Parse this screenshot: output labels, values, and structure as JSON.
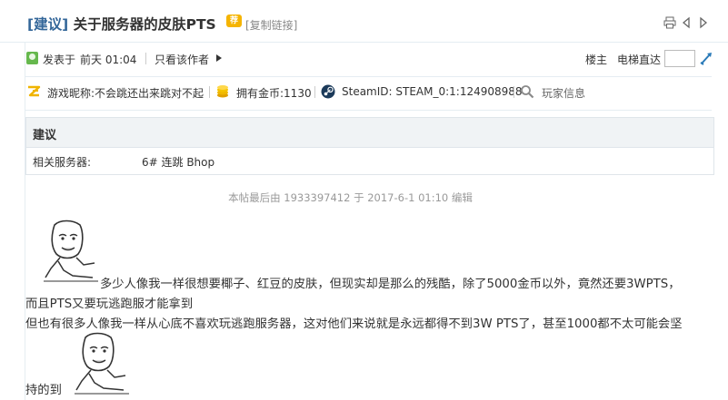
{
  "post": {
    "category": "[建议]",
    "title": "关于服务器的皮肤PTS",
    "hot_badge": "荐",
    "copy_link": "[复制链接]"
  },
  "author_bar": {
    "posted_label": "发表于",
    "posted_time": "前天 01:04",
    "only_author": "只看该作者",
    "floor": "楼主",
    "elevator": "电梯直达"
  },
  "player_info": {
    "nickname": "游戏昵称:不会跳还出来跳对不起",
    "gold": "拥有金币:1130",
    "steam_id": "SteamID: STEAM_0:1:124908988",
    "player_info": "玩家信息"
  },
  "suggestion": {
    "heading": "建议",
    "server_label": "相关服务器:",
    "server_value": "6# 连跳 Bhop"
  },
  "edit_note": "本帖最后由 1933397412 于 2017-6-1 01:10 编辑",
  "body": {
    "line1": "多少人像我一样很想要椰子、红豆的皮肤，但现实却是那么的残酷，除了5000金币以外，竟然还要3WPTS，",
    "line2": "而且PTS又要玩逃跑服才能拿到",
    "line3": "但也有很多人像我一样从心底不喜欢玩逃跑服务器，这对他们来说就是永远都得不到3W PTS了，甚至1000都不太可能会坚",
    "line4": "持的到"
  },
  "icons": {
    "print": "print-icon",
    "prev": "prev-thread-icon",
    "next": "next-thread-icon",
    "author": "author-avatar-icon",
    "nickname": "z-logo-icon",
    "gold": "coins-icon",
    "steam": "steam-icon",
    "search": "magnifier-icon",
    "jump": "jump-icon",
    "face": "meme-face-icon"
  },
  "colors": {
    "category": "#336699",
    "badge": "#f5b400",
    "note": "#999999"
  }
}
